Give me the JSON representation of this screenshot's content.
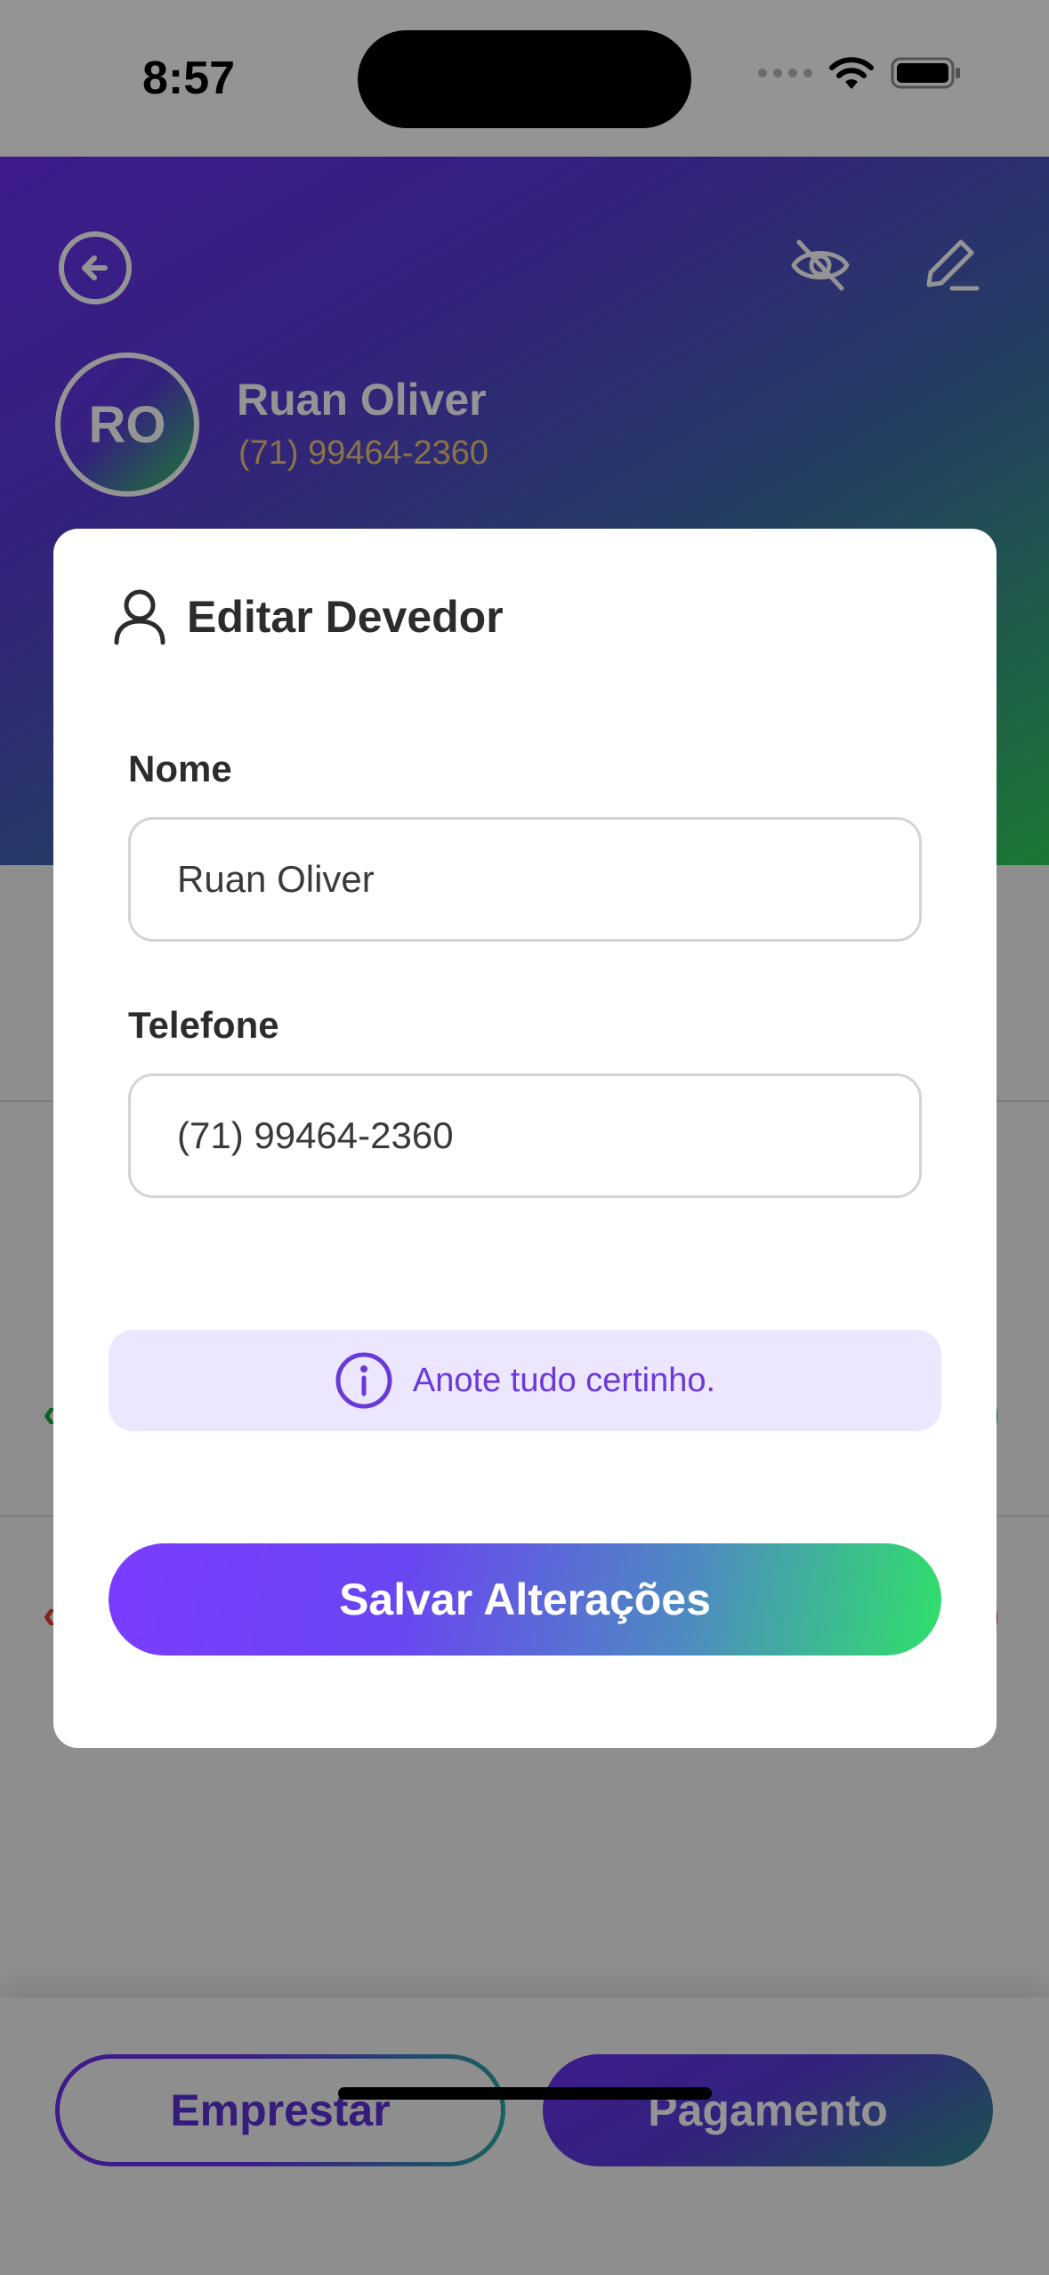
{
  "status_bar": {
    "time": "8:57"
  },
  "header": {
    "avatar_initials": "RO",
    "name": "Ruan Oliver",
    "phone": "(71) 99464-2360"
  },
  "modal": {
    "title": "Editar Devedor",
    "name_label": "Nome",
    "name_value": "Ruan Oliver",
    "phone_label": "Telefone",
    "phone_value": "(71) 99464-2360",
    "info_text": "Anote tudo certinho.",
    "save_label": "Salvar Alterações"
  },
  "bottom_bar": {
    "lend_label": "Emprestar",
    "payment_label": "Pagamento"
  },
  "colors": {
    "accent_purple": "#6a2ff0",
    "accent_green": "#2fcf5c",
    "phone_gold": "#f2c777",
    "info_bg": "#ece6ff",
    "positive": "#1fa84a",
    "negative": "#e53935"
  },
  "icons": [
    "back-arrow-icon",
    "eye-off-icon",
    "pencil-icon",
    "user-icon",
    "info-icon",
    "wifi-icon",
    "battery-icon"
  ]
}
